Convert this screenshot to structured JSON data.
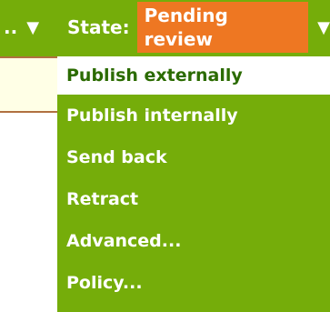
{
  "topbar": {
    "left_menu_label": "..",
    "left_menu_arrow": "▼",
    "state_label": "State:",
    "state_value": "Pending review",
    "state_arrow": "▼"
  },
  "dropdown": {
    "items": [
      {
        "label": "Publish externally"
      },
      {
        "label": "Publish internally"
      },
      {
        "label": "Send back"
      },
      {
        "label": "Retract"
      },
      {
        "label": "Advanced..."
      },
      {
        "label": "Policy..."
      }
    ]
  },
  "colors": {
    "bar_green": "#75ad0a",
    "state_badge_orange": "#ee7722",
    "active_item_text": "#2b6b00",
    "content_background": "#ffffe6"
  }
}
